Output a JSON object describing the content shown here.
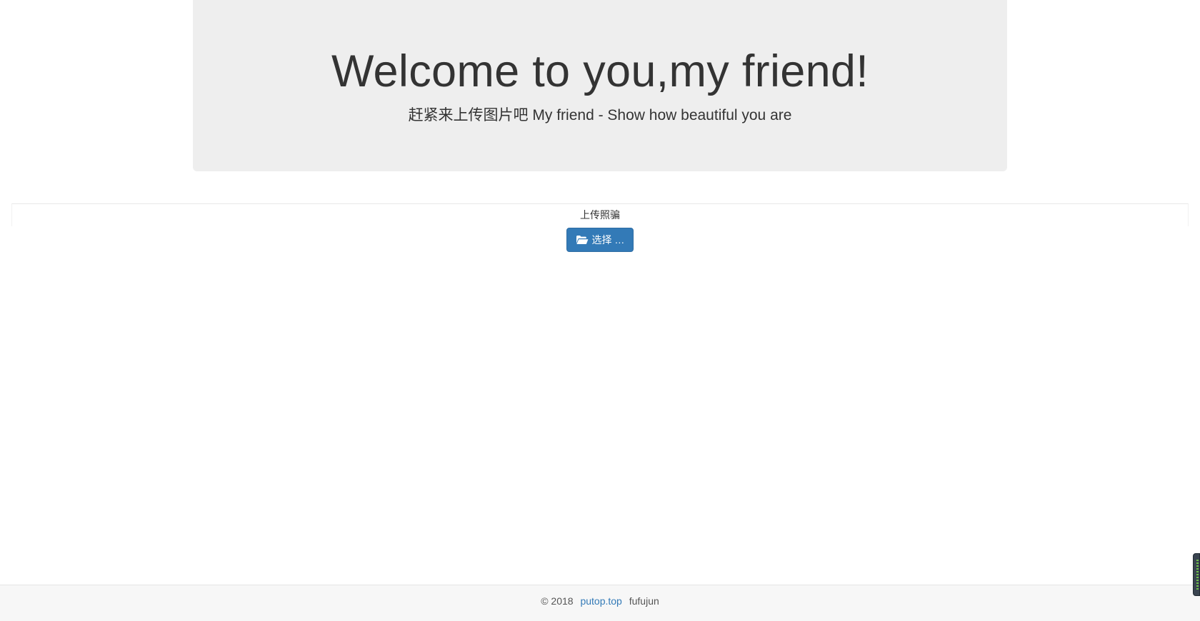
{
  "header": {
    "title": "Welcome to you,my friend!",
    "subtitle": "赶紧来上传图片吧 My friend - Show how beautiful you are"
  },
  "upload": {
    "label": "上传照骗",
    "button_label": "选择 …",
    "button_icon": "folder-open-icon",
    "button_color": "#337ab7"
  },
  "footer": {
    "copyright": "© 2018",
    "link_text": "putop.top",
    "author": "fufujun",
    "link_color": "#337ab7"
  },
  "colors": {
    "jumbotron_bg": "#eeeeee",
    "text": "#333333",
    "footer_bg": "#f7f7f7"
  }
}
